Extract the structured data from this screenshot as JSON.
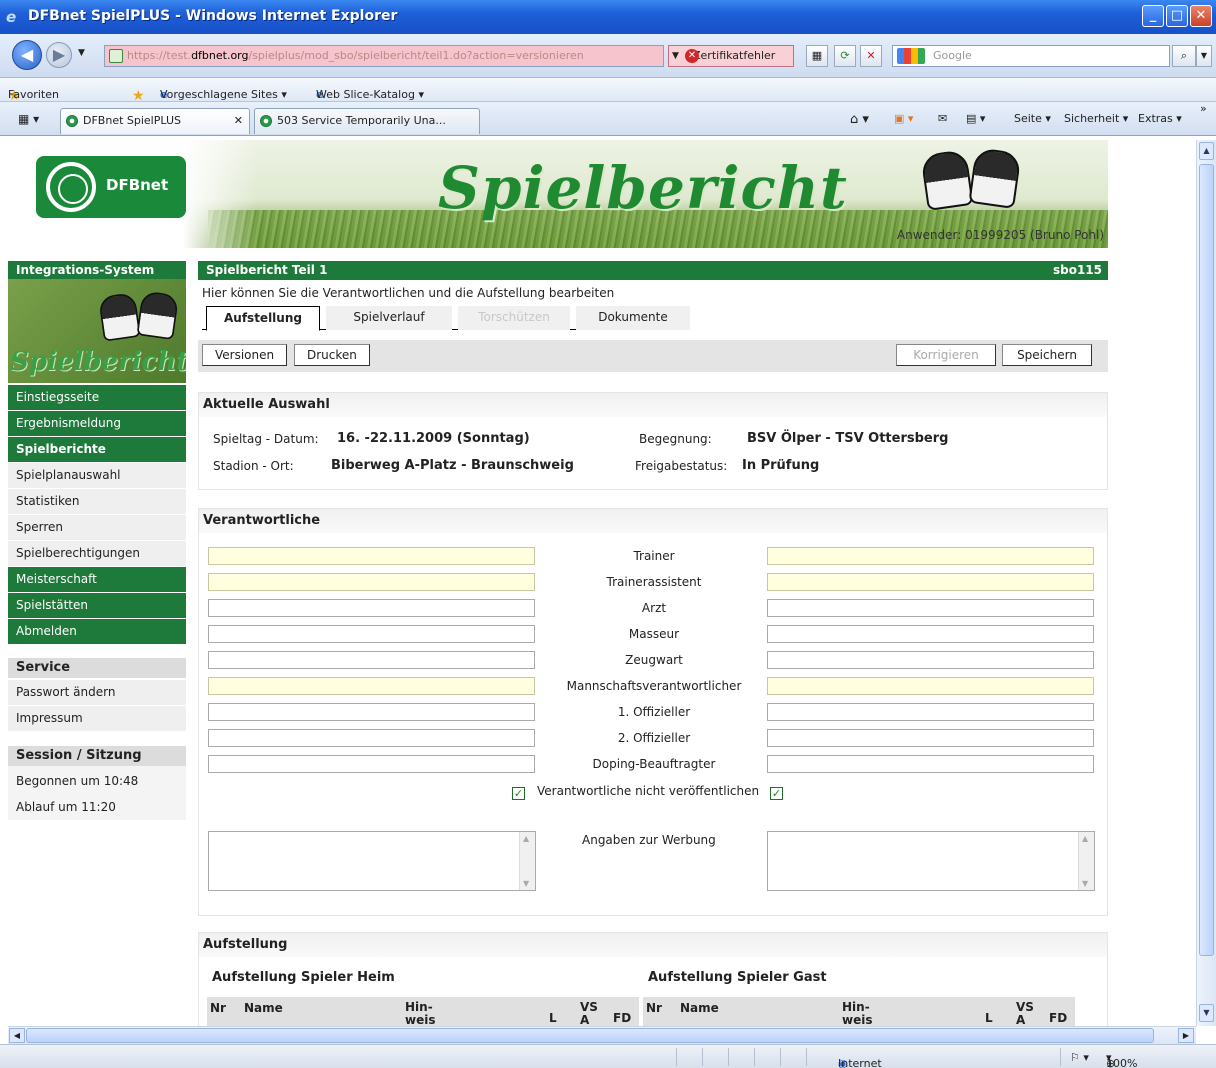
{
  "window": {
    "title": "DFBnet SpielPLUS - Windows Internet Explorer",
    "url_prefix": "https://test.",
    "url_domain": "dfbnet.org",
    "url_path": "/spielplus/mod_sbo/spielbericht/teil1.do?action=versionieren",
    "cert_error": "Zertifikatfehler",
    "search_placeholder": "Google",
    "favorites": "Favoriten",
    "suggested_sites": "Vorgeschlagene Sites ▾",
    "web_slice": "Web Slice-Katalog ▾",
    "tabs": [
      {
        "label": "DFBnet SpielPLUS"
      },
      {
        "label": "503 Service Temporarily Una..."
      }
    ],
    "commands": {
      "seite": "Seite ▾",
      "sicherheit": "Sicherheit ▾",
      "extras": "Extras ▾",
      "more": "»"
    },
    "status": {
      "zone": "Internet",
      "zoom": "100%"
    }
  },
  "banner": {
    "logo_text": "DFBnet",
    "title": "Spielbericht",
    "user": "Anwender: 01999205 (Bruno Pohl)"
  },
  "sidebar": {
    "header": "Integrations-System",
    "image_word": "Spielbericht",
    "items": [
      {
        "label": "Einstiegsseite"
      },
      {
        "label": "Ergebnismeldung"
      },
      {
        "label": "Spielberichte"
      },
      {
        "label": "Spielplanauswahl"
      },
      {
        "label": "Statistiken"
      },
      {
        "label": "Sperren"
      },
      {
        "label": "Spielberechtigungen"
      },
      {
        "label": "Meisterschaft"
      },
      {
        "label": "Spielstätten"
      },
      {
        "label": "Abmelden"
      }
    ],
    "service_header": "Service",
    "service_items": [
      {
        "label": "Passwort ändern"
      },
      {
        "label": "Impressum"
      }
    ],
    "session_header": "Session / Sitzung",
    "session_started": "Begonnen um 10:48",
    "session_expires": "Ablauf um 11:20"
  },
  "content": {
    "title": "Spielbericht Teil 1",
    "code": "sbo115",
    "hint": "Hier können Sie die Verantwortlichen und die Aufstellung bearbeiten",
    "tabs": [
      {
        "label": "Aufstellung"
      },
      {
        "label": "Spielverlauf"
      },
      {
        "label": "Torschützen"
      },
      {
        "label": "Dokumente"
      }
    ],
    "toolbar": {
      "versionen": "Versionen",
      "drucken": "Drucken",
      "korrigieren": "Korrigieren",
      "speichern": "Speichern"
    }
  },
  "auswahl": {
    "header": "Aktuelle Auswahl",
    "spieltag_label": "Spieltag - Datum:",
    "spieltag_value": "16. -22.11.2009 (Sonntag)",
    "begegnung_label": "Begegnung:",
    "begegnung_value": "BSV Ölper - TSV Ottersberg",
    "stadion_label": "Stadion - Ort:",
    "stadion_value": "Biberweg A-Platz - Braunschweig",
    "freigabe_label": "Freigabestatus:",
    "freigabe_value": "In Prüfung"
  },
  "verantwortliche": {
    "header": "Verantwortliche",
    "roles": [
      {
        "label": "Trainer",
        "home": "",
        "guest": ""
      },
      {
        "label": "Trainerassistent",
        "home": "",
        "guest": ""
      },
      {
        "label": "Arzt",
        "home": "",
        "guest": ""
      },
      {
        "label": "Masseur",
        "home": "",
        "guest": ""
      },
      {
        "label": "Zeugwart",
        "home": "",
        "guest": ""
      },
      {
        "label": "Mannschaftsverantwortlicher",
        "home": "",
        "guest": ""
      },
      {
        "label": "1. Offizieller",
        "home": "",
        "guest": ""
      },
      {
        "label": "2. Offizieller",
        "home": "",
        "guest": ""
      },
      {
        "label": "Doping-Beauftragter",
        "home": "",
        "guest": ""
      }
    ],
    "not_publish_label": "Verantwortliche nicht veröffentlichen",
    "not_publish_home": true,
    "not_publish_guest": true,
    "werbung_label": "Angaben zur Werbung"
  },
  "aufstellung": {
    "header": "Aufstellung",
    "home_title": "Aufstellung Spieler Heim",
    "guest_title": "Aufstellung Spieler Gast",
    "columns": {
      "nr": "Nr",
      "name": "Name",
      "hinweis": "Hin-weis",
      "l": "L",
      "vsa": "VS A",
      "fd": "FD"
    }
  }
}
